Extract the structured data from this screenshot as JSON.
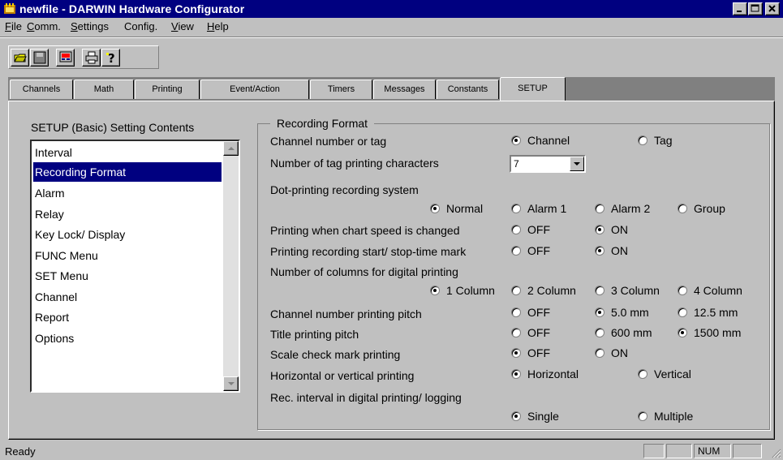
{
  "window": {
    "title": "newfile - DARWIN Hardware Configurator",
    "controls": [
      "minimize",
      "maximize",
      "close"
    ]
  },
  "menu": [
    {
      "label": "File",
      "ul": "F",
      "rest": "ile"
    },
    {
      "label": "Comm.",
      "ul": "C",
      "rest": "omm."
    },
    {
      "label": "Settings",
      "ul": "S",
      "rest": "ettings"
    },
    {
      "label": "Config.",
      "ul": "",
      "rest": "Config."
    },
    {
      "label": "View",
      "ul": "V",
      "rest": "iew"
    },
    {
      "label": "Help",
      "ul": "H",
      "rest": "elp"
    }
  ],
  "toolbar": {
    "icons": [
      "open-folder-icon",
      "save-disk-icon",
      "transfer-icon",
      "print-icon",
      "help-icon"
    ]
  },
  "tabs": [
    "Channels",
    "Math",
    "Printing",
    "Event/Action",
    "Timers",
    "Messages",
    "Constants",
    "SETUP"
  ],
  "active_tab": "SETUP",
  "setup": {
    "heading": "SETUP (Basic) Setting Contents",
    "items": [
      "Interval",
      "Recording Format",
      "Alarm",
      "Relay",
      "Key Lock/ Display",
      "FUNC Menu",
      "SET Menu",
      "Channel",
      "Report",
      "Options"
    ],
    "selected": "Recording Format"
  },
  "recording_format": {
    "legend": "Recording Format",
    "labels": {
      "channel_tag": "Channel number or tag",
      "tag_chars": "Number of tag printing characters",
      "dot_system": "Dot-printing recording system",
      "speed_change": "Printing when chart speed is changed",
      "start_stop": "Printing recording start/ stop-time mark",
      "columns": "Number of columns for digital printing",
      "ch_pitch": "Channel number printing pitch",
      "title_pitch": "Title printing pitch",
      "scale_check": "Scale check mark printing",
      "orientation": "Horizontal or vertical printing",
      "rec_interval": "Rec. interval in digital printing/ logging"
    },
    "tag_chars_value": "7",
    "options": {
      "channel_tag": [
        "Channel",
        "Tag"
      ],
      "dot_system": [
        "Normal",
        "Alarm 1",
        "Alarm 2",
        "Group"
      ],
      "speed_change": [
        "OFF",
        "ON"
      ],
      "start_stop": [
        "OFF",
        "ON"
      ],
      "columns": [
        "1 Column",
        "2 Column",
        "3 Column",
        "4 Column"
      ],
      "ch_pitch": [
        "OFF",
        "5.0 mm",
        "12.5 mm"
      ],
      "title_pitch": [
        "OFF",
        "600 mm",
        "1500 mm"
      ],
      "scale_check": [
        "OFF",
        "ON"
      ],
      "orientation": [
        "Horizontal",
        "Vertical"
      ],
      "rec_interval": [
        "Single",
        "Multiple"
      ]
    },
    "selected": {
      "channel_tag": "Channel",
      "dot_system": "Normal",
      "speed_change": "ON",
      "start_stop": "ON",
      "columns": "1 Column",
      "ch_pitch": "5.0 mm",
      "title_pitch": "1500 mm",
      "scale_check": "OFF",
      "orientation": "Horizontal",
      "rec_interval": "Single"
    }
  },
  "status": {
    "text": "Ready",
    "num": "NUM"
  }
}
